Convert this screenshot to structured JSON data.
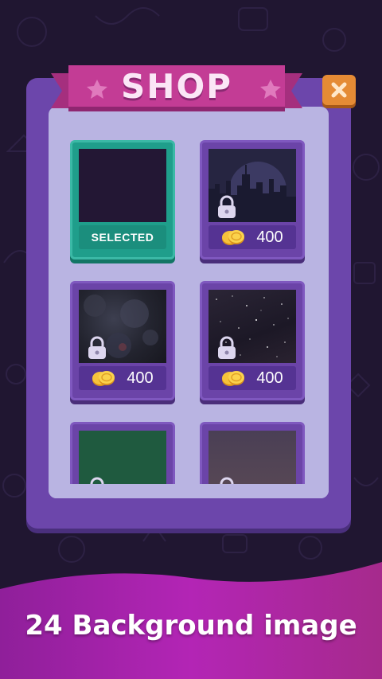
{
  "header": {
    "title": "SHOP"
  },
  "close_button": {
    "icon": "close-icon"
  },
  "items": [
    {
      "state": "selected",
      "label": "SELECTED",
      "theme": "dark"
    },
    {
      "state": "locked",
      "price": "400",
      "theme": "city-night"
    },
    {
      "state": "locked",
      "price": "400",
      "theme": "nebula"
    },
    {
      "state": "locked",
      "price": "400",
      "theme": "starfield"
    },
    {
      "state": "locked",
      "theme": "green"
    },
    {
      "state": "locked",
      "theme": "dusk"
    }
  ],
  "banner": {
    "text": "24 Background image"
  },
  "colors": {
    "background": "#201631",
    "panel": "#6c46ab",
    "panel_inner": "#b9b4e2",
    "ribbon": "#c33c95",
    "selected": "#1f9e8b",
    "close_button": "#e58b35",
    "banner": "#b325b5"
  }
}
